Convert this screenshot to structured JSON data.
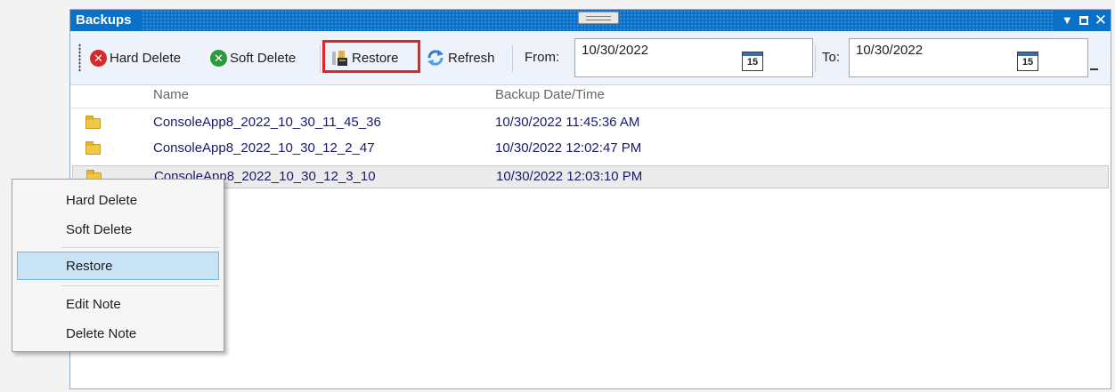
{
  "window": {
    "title": "Backups"
  },
  "toolbar": {
    "hard_delete": "Hard Delete",
    "soft_delete": "Soft Delete",
    "restore": "Restore",
    "refresh": "Refresh",
    "from_label": "From:",
    "from_value": "10/30/2022",
    "to_label": "To:",
    "to_value": "10/30/2022",
    "calendar_day": "15"
  },
  "list": {
    "columns": [
      "Name",
      "Backup Date/Time"
    ],
    "rows": [
      {
        "name": "ConsoleApp8_2022_10_30_11_45_36",
        "date": "10/30/2022 11:45:36 AM"
      },
      {
        "name": "ConsoleApp8_2022_10_30_12_2_47",
        "date": "10/30/2022 12:02:47 PM"
      },
      {
        "name": "ConsoleApp8_2022_10_30_12_3_10",
        "date": "10/30/2022 12:03:10 PM"
      }
    ]
  },
  "context_menu": {
    "items": [
      "Hard Delete",
      "Soft Delete",
      "Restore",
      "Edit Note",
      "Delete Note"
    ],
    "highlighted": "Restore"
  },
  "colors": {
    "titlebar": "#0a71c9",
    "delete_red": "#d42a2a",
    "soft_green": "#2a9a3a",
    "highlight_frame": "#e0242a",
    "menu_highlight": "#c7e3f5"
  },
  "icons": {
    "hard_delete": "red-x-circle-icon",
    "soft_delete": "green-x-circle-icon",
    "restore": "restore-icon",
    "refresh": "refresh-icon",
    "calendar": "calendar-icon",
    "folder": "folder-icon"
  }
}
